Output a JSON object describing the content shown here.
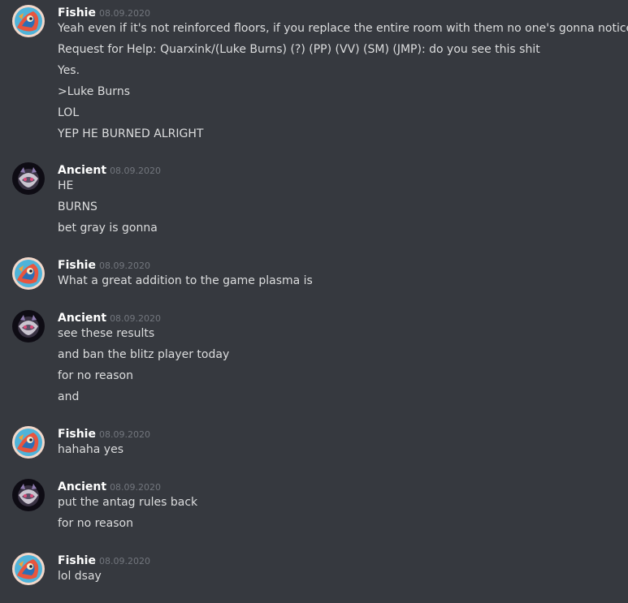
{
  "colors": {
    "background": "#36393f",
    "username": "#ffffff",
    "timestamp": "#72767d",
    "text": "#dcddde"
  },
  "groups": [
    {
      "author": "Fishie",
      "avatar_icon": "fishie-avatar-icon",
      "timestamp": "08.09.2020",
      "messages": [
        "Yeah even if it's not reinforced floors, if you replace the entire room with them no one's gonna notice",
        "Request for Help: Quarxink/(Luke Burns) (?) (PP) (VV) (SM) (JMP): do you see this shit",
        "Yes.",
        ">Luke Burns",
        "LOL",
        "YEP HE BURNED ALRIGHT"
      ]
    },
    {
      "author": "Ancient",
      "avatar_icon": "ancient-avatar-icon",
      "timestamp": "08.09.2020",
      "messages": [
        "HE",
        "BURNS",
        "bet gray is gonna"
      ]
    },
    {
      "author": "Fishie",
      "avatar_icon": "fishie-avatar-icon",
      "timestamp": "08.09.2020",
      "messages": [
        "What a great addition to the game plasma is"
      ]
    },
    {
      "author": "Ancient",
      "avatar_icon": "ancient-avatar-icon",
      "timestamp": "08.09.2020",
      "messages": [
        "see these results",
        "and ban the blitz player today",
        "for no reason",
        "and"
      ]
    },
    {
      "author": "Fishie",
      "avatar_icon": "fishie-avatar-icon",
      "timestamp": "08.09.2020",
      "messages": [
        "hahaha yes"
      ]
    },
    {
      "author": "Ancient",
      "avatar_icon": "ancient-avatar-icon",
      "timestamp": "08.09.2020",
      "messages": [
        "put the antag rules back",
        "for no reason"
      ]
    },
    {
      "author": "Fishie",
      "avatar_icon": "fishie-avatar-icon",
      "timestamp": "08.09.2020",
      "messages": [
        "lol dsay"
      ]
    }
  ]
}
